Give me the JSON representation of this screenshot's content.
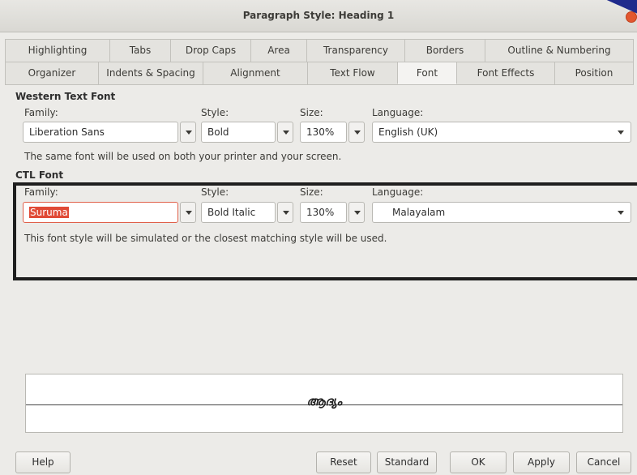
{
  "window": {
    "title": "Paragraph Style: Heading 1"
  },
  "tabs": {
    "row1": [
      "Highlighting",
      "Tabs",
      "Drop Caps",
      "Area",
      "Transparency",
      "Borders",
      "Outline & Numbering"
    ],
    "row2": [
      "Organizer",
      "Indents & Spacing",
      "Alignment",
      "Text Flow",
      "Font",
      "Font Effects",
      "Position"
    ],
    "active": "Font"
  },
  "western": {
    "heading": "Western Text Font",
    "family_label": "Family:",
    "style_label": "Style:",
    "size_label": "Size:",
    "language_label": "Language:",
    "family": "Liberation Sans",
    "style": "Bold",
    "size": "130%",
    "language": "English (UK)",
    "note": "The same font will be used on both your printer and your screen."
  },
  "ctl": {
    "heading": "CTL Font",
    "family_label": "Family:",
    "style_label": "Style:",
    "size_label": "Size:",
    "language_label": "Language:",
    "family": "Suruma",
    "style": "Bold Italic",
    "size": "130%",
    "language": "Malayalam",
    "note": "This font style will be simulated or the closest matching style will be used."
  },
  "preview": {
    "sample": "ആദ്യം"
  },
  "buttons": {
    "help": "Help",
    "reset": "Reset",
    "standard": "Standard",
    "ok": "OK",
    "apply": "Apply",
    "cancel": "Cancel"
  },
  "colors": {
    "selection": "#e04a36",
    "close_button": "#e2572f",
    "highlight_frame": "#1e1e1e"
  }
}
